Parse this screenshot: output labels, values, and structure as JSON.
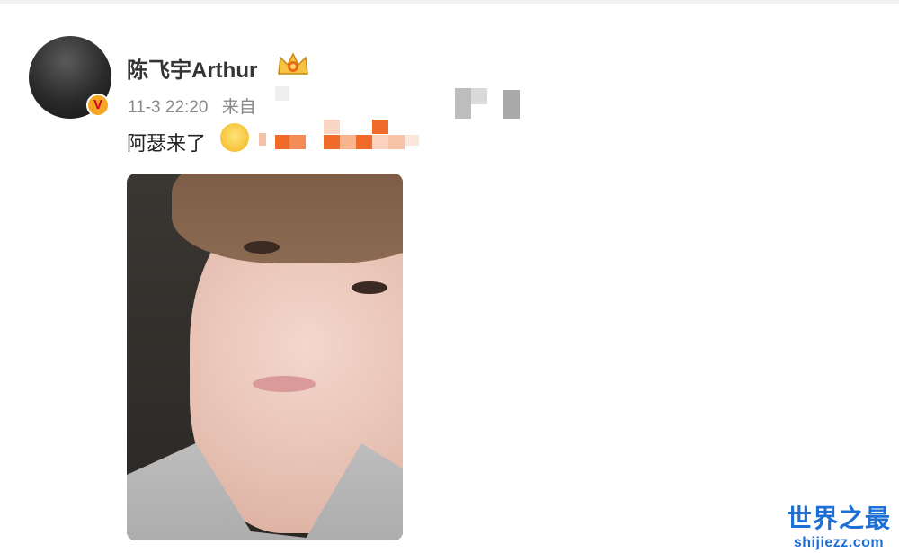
{
  "post": {
    "author": "陈飞宇Arthur",
    "timestamp": "11-3 22:20",
    "source_prefix": "来自",
    "text": "阿瑟来了",
    "emoji": "laughing-crying-emoji",
    "verified_badge": "V"
  },
  "watermark": {
    "title": "世界之最",
    "subtitle": "shijiezz.com"
  },
  "colors": {
    "author": "#333333",
    "meta": "#888888",
    "badge": "#f5a623",
    "watermark": "#1d6fd6"
  }
}
